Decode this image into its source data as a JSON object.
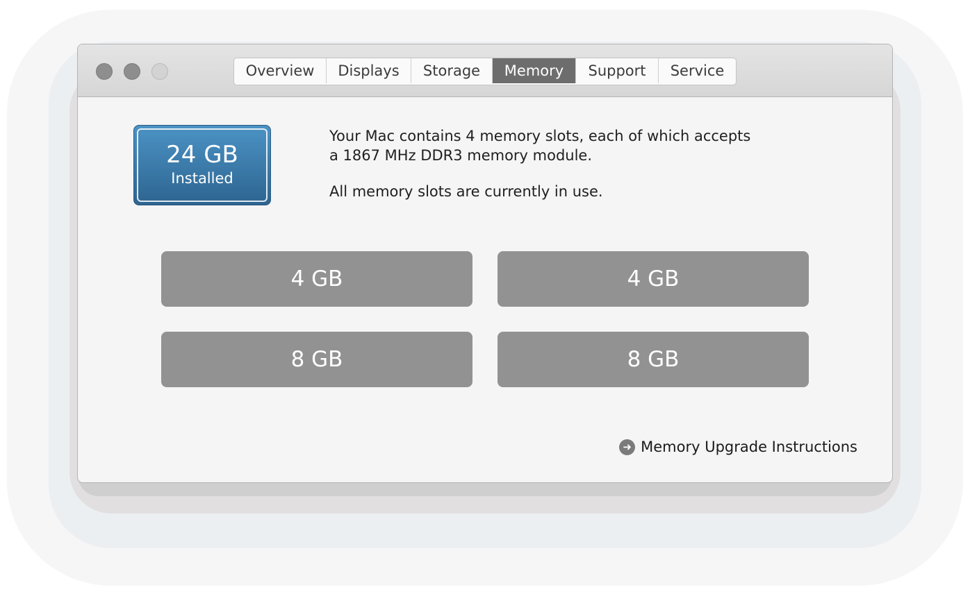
{
  "window": {
    "traffic_lights": [
      "close",
      "minimize",
      "zoom"
    ]
  },
  "tabs": [
    {
      "label": "Overview",
      "active": false
    },
    {
      "label": "Displays",
      "active": false
    },
    {
      "label": "Storage",
      "active": false
    },
    {
      "label": "Memory",
      "active": true
    },
    {
      "label": "Support",
      "active": false
    },
    {
      "label": "Service",
      "active": false
    }
  ],
  "memory": {
    "installed_size": "24 GB",
    "installed_label": "Installed",
    "description_line1": "Your Mac contains 4 memory slots, each of which accepts",
    "description_line2": "a 1867 MHz DDR3 memory module.",
    "status": "All memory slots are currently in use.",
    "slots": [
      "4 GB",
      "4 GB",
      "8 GB",
      "8 GB"
    ],
    "upgrade_link": "Memory Upgrade Instructions",
    "upgrade_icon": "arrow-circle-right-icon"
  },
  "colors": {
    "badge_top": "#4b93c5",
    "badge_bottom": "#2d6490",
    "slot_fill": "#929292",
    "active_tab": "#6d6d6d"
  }
}
